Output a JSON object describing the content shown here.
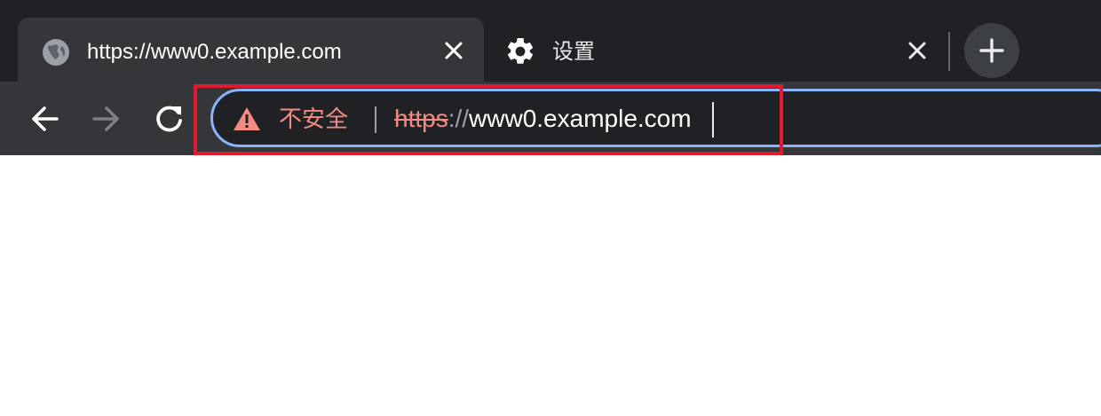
{
  "colors": {
    "tabstrip_bg": "#202124",
    "toolbar_bg": "#35363a",
    "omnibox_border": "#8ab4f8",
    "warning_red": "#f28b82",
    "highlight_box": "#e21b2c"
  },
  "tabs": [
    {
      "title": "https://www0.example.com",
      "icon": "globe-icon",
      "active": true
    },
    {
      "title": "设置",
      "icon": "gear-icon",
      "active": false
    }
  ],
  "toolbar": {
    "back_icon": "back-arrow-icon",
    "forward_icon": "forward-arrow-icon",
    "reload_icon": "reload-icon",
    "new_tab_icon": "plus-icon"
  },
  "omnibox": {
    "security_label": "不安全",
    "security_icon": "warning-triangle-icon",
    "url_scheme": "https",
    "url_separator": "://",
    "url_host": "www0.example.com"
  }
}
